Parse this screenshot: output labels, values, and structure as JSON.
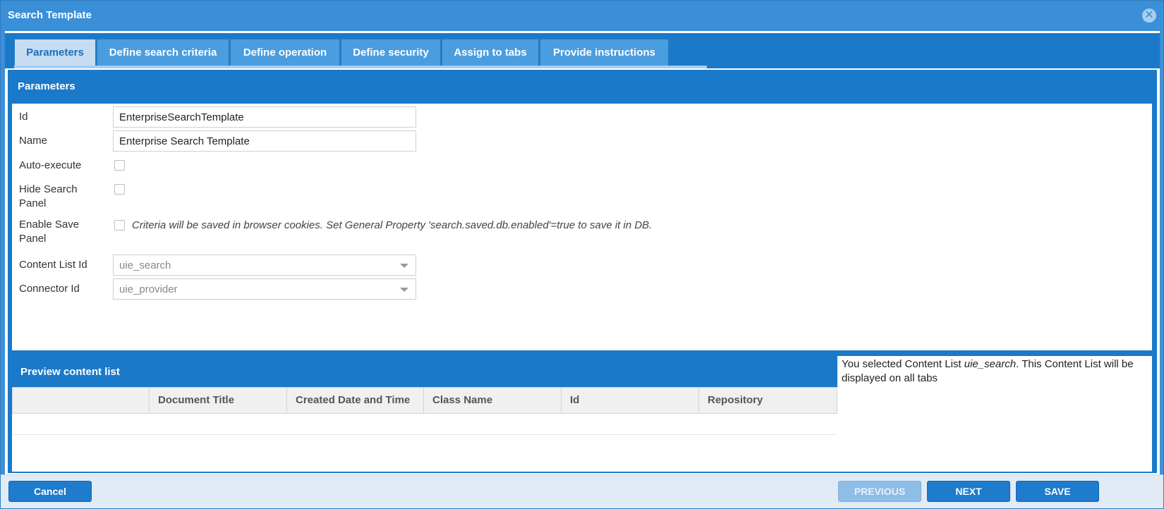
{
  "window": {
    "title": "Search Template"
  },
  "tabs": [
    {
      "label": "Parameters",
      "active": true
    },
    {
      "label": "Define search criteria"
    },
    {
      "label": "Define operation"
    },
    {
      "label": "Define security"
    },
    {
      "label": "Assign to tabs"
    },
    {
      "label": "Provide instructions"
    }
  ],
  "parameters": {
    "header": "Parameters",
    "id": {
      "label": "Id",
      "value": "EnterpriseSearchTemplate"
    },
    "name": {
      "label": "Name",
      "value": "Enterprise Search Template"
    },
    "auto_execute": {
      "label": "Auto-execute",
      "checked": false
    },
    "hide_search_panel": {
      "label_line1": "Hide Search",
      "label_line2": "Panel",
      "checked": false
    },
    "enable_save_panel": {
      "label_line1": "Enable Save",
      "label_line2": "Panel",
      "checked": false,
      "hint": "Criteria will be saved in browser cookies. Set General Property 'search.saved.db.enabled'=true to save it in DB."
    },
    "content_list_id": {
      "label": "Content List Id",
      "value": "uie_search"
    },
    "connector_id": {
      "label": "Connector Id",
      "value": "uie_provider"
    }
  },
  "preview": {
    "header": "Preview content list",
    "columns": [
      "",
      "Document Title",
      "Created Date and Time",
      "Class Name",
      "Id",
      "Repository"
    ],
    "note_prefix": "You selected Content List ",
    "note_list": "uie_search",
    "note_suffix": ". This Content List will be displayed on all tabs"
  },
  "footer": {
    "cancel": "Cancel",
    "previous": "PREVIOUS",
    "next": "NEXT",
    "save": "SAVE"
  },
  "colors": {
    "primary": "#1a79c9",
    "title_bar": "#3a8fd7",
    "tab_active_bg": "#c6dcf1",
    "button": "#1f7bcc",
    "button_disabled": "#8ebde6"
  }
}
